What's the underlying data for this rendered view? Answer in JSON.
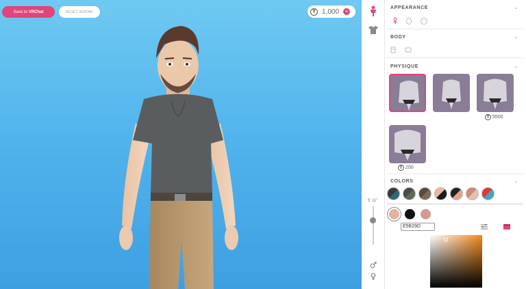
{
  "toolbar": {
    "save_prefix": "Save to",
    "save_brand": "VRChat",
    "reset_label": "RESET AVATAR",
    "token_symbol": "T",
    "token_amount": "1,000",
    "plus": "+"
  },
  "sidebar_tabs": [
    {
      "icon": "person-icon",
      "active": true
    },
    {
      "icon": "shirt-icon",
      "active": false
    }
  ],
  "height": {
    "label": "5' 11\"",
    "level": 0.28
  },
  "gender_icons": [
    "male-icon",
    "female-icon"
  ],
  "sections": {
    "appearance": {
      "title": "APPEARANCE"
    },
    "body": {
      "title": "BODY"
    },
    "physique": {
      "title": "PHYSIQUE",
      "options": [
        {
          "selected": true,
          "price": ""
        },
        {
          "selected": false,
          "price": ""
        },
        {
          "selected": false,
          "price": "5500"
        },
        {
          "selected": false,
          "price": "200"
        }
      ]
    },
    "colors": {
      "title": "COLORS",
      "palette": [
        [
          "#3a3a3a",
          "#2b6b78"
        ],
        [
          "#4a4a4a",
          "#5a6b5a"
        ],
        [
          "#5a4a3e",
          "#7b6a58"
        ],
        [
          "#e8b89a",
          "#1c1c1c"
        ],
        [
          "#222222",
          "#e0a48a"
        ],
        [
          "#c98b7a",
          "#e3bfae"
        ],
        [
          "#d93a3a",
          "#3aa7c9"
        ]
      ],
      "selected_colors": [
        "#e5b29d",
        "#111111",
        "#d89990"
      ],
      "hex_value": "E5B29D",
      "accent": "#e0457b"
    }
  }
}
